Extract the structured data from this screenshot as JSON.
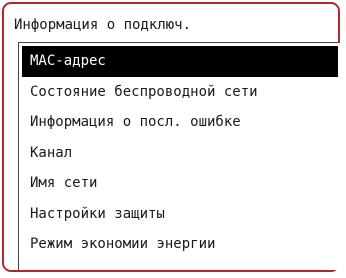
{
  "screen": {
    "title": "Информация о подключ."
  },
  "menu": {
    "items": [
      {
        "label": "МАС-адрес",
        "selected": true
      },
      {
        "label": "Состояние беспроводной сети",
        "selected": false
      },
      {
        "label": "Информация о посл. ошибке",
        "selected": false
      },
      {
        "label": "Канал",
        "selected": false
      },
      {
        "label": "Имя сети",
        "selected": false
      },
      {
        "label": "Настройки защиты",
        "selected": false
      },
      {
        "label": "Режим экономии энергии",
        "selected": false
      }
    ]
  },
  "colors": {
    "frame_border": "#b3262e",
    "selected_bg": "#000000",
    "selected_text": "#ffffff",
    "text": "#1a1a1a"
  }
}
